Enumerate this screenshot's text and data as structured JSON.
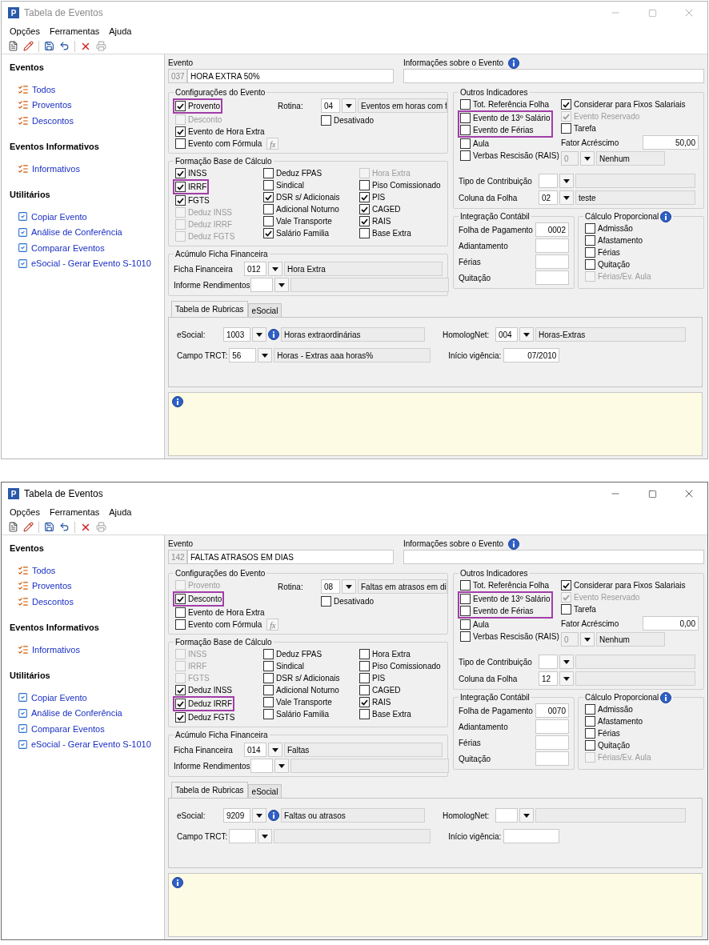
{
  "windows": [
    {
      "title": "Tabela de Eventos",
      "active": false,
      "app_icon": "P",
      "menu": [
        "Opções",
        "Ferramentas",
        "Ajuda"
      ],
      "sidebar": [
        {
          "title": "Eventos",
          "items": [
            {
              "label": "Todos",
              "kind": "list"
            },
            {
              "label": "Proventos",
              "kind": "list"
            },
            {
              "label": "Descontos",
              "kind": "list"
            }
          ]
        },
        {
          "title": "Eventos Informativos",
          "items": [
            {
              "label": "Informativos",
              "kind": "list"
            }
          ]
        },
        {
          "title": "Utilitários",
          "items": [
            {
              "label": "Copiar Evento",
              "kind": "tool"
            },
            {
              "label": "Análise de Conferência",
              "kind": "tool"
            },
            {
              "label": "Comparar Eventos",
              "kind": "tool"
            },
            {
              "label": "eSocial - Gerar Evento S-1010",
              "kind": "tool"
            }
          ]
        }
      ],
      "evento": {
        "label": "Evento",
        "code": "037",
        "name": "HORA EXTRA 50%",
        "info_label": "Informações sobre o Evento"
      },
      "config": {
        "title": "Configurações do Evento",
        "formula_button": "fx",
        "rotina_label": "Rotina:",
        "rotina_code": "04",
        "rotina_desc": "Eventos em horas com f",
        "checks": [
          {
            "label": "Provento",
            "checked": true,
            "disabled": false,
            "highlighted": true
          },
          {
            "label": "Desconto",
            "checked": false,
            "disabled": true,
            "highlighted": false
          },
          {
            "label": "Evento de Hora Extra",
            "checked": true,
            "disabled": false,
            "highlighted": false
          },
          {
            "label": "Evento com Fórmula",
            "checked": false,
            "disabled": false,
            "highlighted": false
          }
        ],
        "desativado": {
          "label": "Desativado",
          "checked": false,
          "disabled": false,
          "highlighted": false
        }
      },
      "base": {
        "title": "Formação Base de Cálculo",
        "columns": [
          [
            {
              "label": "INSS",
              "checked": true,
              "disabled": false,
              "highlighted": false
            },
            {
              "label": "IRRF",
              "checked": true,
              "disabled": false,
              "highlighted": true
            },
            {
              "label": "FGTS",
              "checked": true,
              "disabled": false,
              "highlighted": false
            },
            {
              "label": "Deduz INSS",
              "checked": false,
              "disabled": true,
              "highlighted": false
            },
            {
              "label": "Deduz IRRF",
              "checked": false,
              "disabled": true,
              "highlighted": false
            },
            {
              "label": "Deduz FGTS",
              "checked": false,
              "disabled": true,
              "highlighted": false
            }
          ],
          [
            {
              "label": "Deduz FPAS",
              "checked": false,
              "disabled": false,
              "highlighted": false
            },
            {
              "label": "Sindical",
              "checked": false,
              "disabled": false,
              "highlighted": false
            },
            {
              "label": "DSR s/ Adicionais",
              "checked": true,
              "disabled": false,
              "highlighted": false
            },
            {
              "label": "Adicional Noturno",
              "checked": false,
              "disabled": false,
              "highlighted": false
            },
            {
              "label": "Vale Transporte",
              "checked": false,
              "disabled": false,
              "highlighted": false
            },
            {
              "label": "Salário Familia",
              "checked": true,
              "disabled": false,
              "highlighted": false
            }
          ],
          [
            {
              "label": "Hora Extra",
              "checked": false,
              "disabled": true,
              "highlighted": false
            },
            {
              "label": "Piso Comissionado",
              "checked": false,
              "disabled": false,
              "highlighted": false
            },
            {
              "label": "PIS",
              "checked": true,
              "disabled": false,
              "highlighted": false
            },
            {
              "label": "CAGED",
              "checked": true,
              "disabled": false,
              "highlighted": false
            },
            {
              "label": "RAIS",
              "checked": true,
              "disabled": false,
              "highlighted": false
            },
            {
              "label": "Base Extra",
              "checked": false,
              "disabled": false,
              "highlighted": false
            }
          ]
        ]
      },
      "acumulo": {
        "title": "Acúmulo Ficha Financeira",
        "rows": [
          {
            "label": "Ficha Financeira",
            "code": "012",
            "desc": "Hora Extra"
          },
          {
            "label": "Informe Rendimentos"
          }
        ]
      },
      "outros": {
        "title": "Outros Indicadores",
        "left": [
          {
            "label": "Tot. Referência Folha",
            "checked": false,
            "disabled": false,
            "highlighted": false
          },
          {
            "label": "Evento de 13º Salário",
            "checked": false,
            "disabled": false,
            "highlighted": true
          },
          {
            "label": "Evento de Férias",
            "checked": false,
            "disabled": false,
            "highlighted": true
          },
          {
            "label": "Aula",
            "checked": false,
            "disabled": false,
            "highlighted": false
          },
          {
            "label": "Verbas Rescisão (RAIS)",
            "checked": false,
            "disabled": false,
            "highlighted": false
          }
        ],
        "right": [
          {
            "label": "Considerar para Fixos Salariais",
            "checked": true,
            "disabled": false,
            "highlighted": false
          },
          {
            "label": "Evento Reservado",
            "checked": true,
            "disabled": true,
            "highlighted": false
          },
          {
            "label": "Tarefa",
            "checked": false,
            "disabled": false,
            "highlighted": false
          }
        ],
        "fator_label": "Fator Acréscimo",
        "fator_value": "50,00",
        "combo_code": "0",
        "combo_desc": "Nenhum",
        "combo_disabled": true,
        "rows": [
          {
            "label": "Tipo de Contribuição"
          },
          {
            "label": "Coluna da Folha",
            "code": "02",
            "desc": "teste"
          }
        ]
      },
      "integracao": {
        "title": "Integração Contábil",
        "rows": [
          {
            "label": "Folha de Pagamento",
            "value": "0002"
          },
          {
            "label": "Adiantamento"
          },
          {
            "label": "Férias"
          },
          {
            "label": "Quitação"
          }
        ]
      },
      "calculo": {
        "title": "Cálculo Proporcional",
        "checks": [
          {
            "label": "Admissão",
            "checked": false,
            "disabled": false,
            "highlighted": false
          },
          {
            "label": "Afastamento",
            "checked": false,
            "disabled": false,
            "highlighted": false
          },
          {
            "label": "Férias",
            "checked": false,
            "disabled": false,
            "highlighted": false
          },
          {
            "label": "Quitação",
            "checked": false,
            "disabled": false,
            "highlighted": false
          },
          {
            "label": "Férias/Ev. Aula",
            "checked": false,
            "disabled": true,
            "highlighted": false
          }
        ]
      },
      "tabs": [
        {
          "label": "Tabela de Rubricas",
          "selected": true
        },
        {
          "label": "eSocial",
          "selected": false
        }
      ],
      "rubricas": {
        "esocial": {
          "label": "eSocial:",
          "code": "1003",
          "desc": "Horas extraordinárias"
        },
        "homolog": {
          "label": "HomologNet:",
          "code": "004",
          "desc": "Horas-Extras"
        },
        "trct": {
          "label": "Campo TRCT:",
          "code": "56",
          "desc": "Horas - Extras aaa horas%"
        },
        "inicio": {
          "label": "Início vigência:",
          "value": "07/2010"
        }
      }
    },
    {
      "title": "Tabela de Eventos",
      "active": true,
      "app_icon": "P",
      "menu": [
        "Opções",
        "Ferramentas",
        "Ajuda"
      ],
      "sidebar": [
        {
          "title": "Eventos",
          "items": [
            {
              "label": "Todos",
              "kind": "list"
            },
            {
              "label": "Proventos",
              "kind": "list"
            },
            {
              "label": "Descontos",
              "kind": "list"
            }
          ]
        },
        {
          "title": "Eventos Informativos",
          "items": [
            {
              "label": "Informativos",
              "kind": "list"
            }
          ]
        },
        {
          "title": "Utilitários",
          "items": [
            {
              "label": "Copiar Evento",
              "kind": "tool"
            },
            {
              "label": "Análise de Conferência",
              "kind": "tool"
            },
            {
              "label": "Comparar Eventos",
              "kind": "tool"
            },
            {
              "label": "eSocial - Gerar Evento S-1010",
              "kind": "tool"
            }
          ]
        }
      ],
      "evento": {
        "label": "Evento",
        "code": "142",
        "name": "FALTAS ATRASOS EM DIAS",
        "info_label": "Informações sobre o Evento"
      },
      "config": {
        "title": "Configurações do Evento",
        "formula_button": "fx",
        "rotina_label": "Rotina:",
        "rotina_code": "08",
        "rotina_desc": "Faltas em atrasos em di",
        "checks": [
          {
            "label": "Provento",
            "checked": false,
            "disabled": true,
            "highlighted": false
          },
          {
            "label": "Desconto",
            "checked": true,
            "disabled": false,
            "highlighted": true
          },
          {
            "label": "Evento de Hora Extra",
            "checked": false,
            "disabled": false,
            "highlighted": false
          },
          {
            "label": "Evento com Fórmula",
            "checked": false,
            "disabled": false,
            "highlighted": false
          }
        ],
        "desativado": {
          "label": "Desativado",
          "checked": false,
          "disabled": false,
          "highlighted": false
        }
      },
      "base": {
        "title": "Formação Base de Cálculo",
        "columns": [
          [
            {
              "label": "INSS",
              "checked": false,
              "disabled": true,
              "highlighted": false
            },
            {
              "label": "IRRF",
              "checked": false,
              "disabled": true,
              "highlighted": false
            },
            {
              "label": "FGTS",
              "checked": false,
              "disabled": true,
              "highlighted": false
            },
            {
              "label": "Deduz INSS",
              "checked": true,
              "disabled": false,
              "highlighted": false
            },
            {
              "label": "Deduz IRRF",
              "checked": true,
              "disabled": false,
              "highlighted": true
            },
            {
              "label": "Deduz FGTS",
              "checked": true,
              "disabled": false,
              "highlighted": false
            }
          ],
          [
            {
              "label": "Deduz FPAS",
              "checked": false,
              "disabled": false,
              "highlighted": false
            },
            {
              "label": "Sindical",
              "checked": false,
              "disabled": false,
              "highlighted": false
            },
            {
              "label": "DSR s/ Adicionais",
              "checked": false,
              "disabled": false,
              "highlighted": false
            },
            {
              "label": "Adicional Noturno",
              "checked": false,
              "disabled": false,
              "highlighted": false
            },
            {
              "label": "Vale Transporte",
              "checked": false,
              "disabled": false,
              "highlighted": false
            },
            {
              "label": "Salário Familia",
              "checked": false,
              "disabled": false,
              "highlighted": false
            }
          ],
          [
            {
              "label": "Hora Extra",
              "checked": false,
              "disabled": false,
              "highlighted": false
            },
            {
              "label": "Piso Comissionado",
              "checked": false,
              "disabled": false,
              "highlighted": false
            },
            {
              "label": "PIS",
              "checked": false,
              "disabled": false,
              "highlighted": false
            },
            {
              "label": "CAGED",
              "checked": false,
              "disabled": false,
              "highlighted": false
            },
            {
              "label": "RAIS",
              "checked": true,
              "disabled": false,
              "highlighted": false
            },
            {
              "label": "Base Extra",
              "checked": false,
              "disabled": false,
              "highlighted": false
            }
          ]
        ]
      },
      "acumulo": {
        "title": "Acúmulo Ficha Financeira",
        "rows": [
          {
            "label": "Ficha Financeira",
            "code": "014",
            "desc": "Faltas"
          },
          {
            "label": "Informe Rendimentos"
          }
        ]
      },
      "outros": {
        "title": "Outros Indicadores",
        "left": [
          {
            "label": "Tot. Referência Folha",
            "checked": false,
            "disabled": false,
            "highlighted": false
          },
          {
            "label": "Evento de 13º Salário",
            "checked": false,
            "disabled": false,
            "highlighted": true
          },
          {
            "label": "Evento de Férias",
            "checked": false,
            "disabled": false,
            "highlighted": true
          },
          {
            "label": "Aula",
            "checked": false,
            "disabled": false,
            "highlighted": false
          },
          {
            "label": "Verbas Rescisão (RAIS)",
            "checked": false,
            "disabled": false,
            "highlighted": false
          }
        ],
        "right": [
          {
            "label": "Considerar para Fixos Salariais",
            "checked": true,
            "disabled": false,
            "highlighted": false
          },
          {
            "label": "Evento Reservado",
            "checked": true,
            "disabled": true,
            "highlighted": false
          },
          {
            "label": "Tarefa",
            "checked": false,
            "disabled": false,
            "highlighted": false
          }
        ],
        "fator_label": "Fator Acréscimo",
        "fator_value": "0,00",
        "combo_code": "0",
        "combo_desc": "Nenhum",
        "combo_disabled": true,
        "rows": [
          {
            "label": "Tipo de Contribuição"
          },
          {
            "label": "Coluna da Folha",
            "code": "12"
          }
        ]
      },
      "integracao": {
        "title": "Integração Contábil",
        "rows": [
          {
            "label": "Folha de Pagamento",
            "value": "0070"
          },
          {
            "label": "Adiantamento"
          },
          {
            "label": "Férias"
          },
          {
            "label": "Quitação"
          }
        ]
      },
      "calculo": {
        "title": "Cálculo Proporcional",
        "checks": [
          {
            "label": "Admissão",
            "checked": false,
            "disabled": false,
            "highlighted": false
          },
          {
            "label": "Afastamento",
            "checked": false,
            "disabled": false,
            "highlighted": false
          },
          {
            "label": "Férias",
            "checked": false,
            "disabled": false,
            "highlighted": false
          },
          {
            "label": "Quitação",
            "checked": false,
            "disabled": false,
            "highlighted": false
          },
          {
            "label": "Férias/Ev. Aula",
            "checked": false,
            "disabled": true,
            "highlighted": false
          }
        ]
      },
      "tabs": [
        {
          "label": "Tabela de Rubricas",
          "selected": true
        },
        {
          "label": "eSocial",
          "selected": false
        }
      ],
      "rubricas": {
        "esocial": {
          "label": "eSocial:",
          "code": "9209",
          "desc": "Faltas ou atrasos"
        },
        "homolog": {
          "label": "HomologNet:"
        },
        "trct": {
          "label": "Campo TRCT:"
        },
        "inicio": {
          "label": "Início vigência:"
        }
      }
    }
  ]
}
